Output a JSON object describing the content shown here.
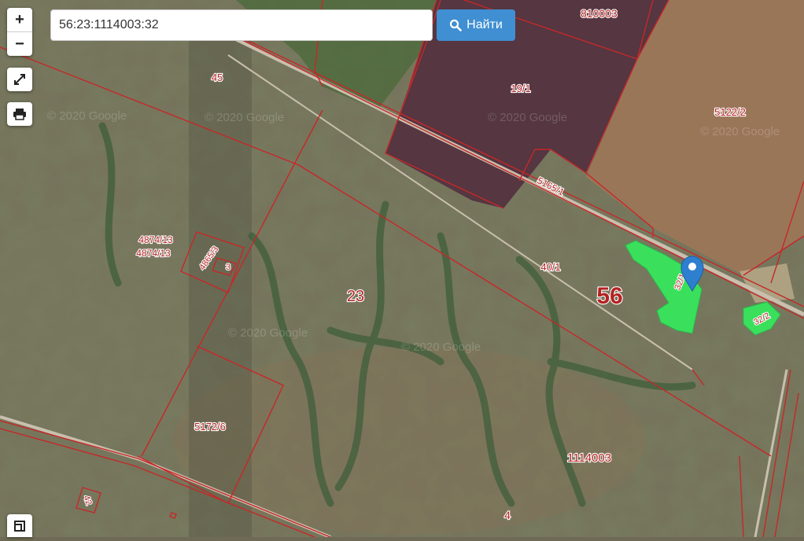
{
  "search": {
    "value": "56:23:1114003:32",
    "button_label": "Найти"
  },
  "controls": {
    "zoom_in": "+",
    "zoom_out": "−"
  },
  "labels": {
    "quarter_810003": "810003",
    "parcel_19_1": "19/1",
    "parcel_5122_2": "5122/2",
    "parcel_45": "45",
    "parcel_5165_1": "5165/1",
    "parcel_4874_13_a": "4874/13",
    "parcel_4874_13_b": "4874/13",
    "parcel_4865_3": "4865/3",
    "parcel_3": "3",
    "parcel_40_1": "40/1",
    "region_56": "56",
    "district_23": "23",
    "parcel_32_1": "32/1",
    "parcel_32_2": "32/2",
    "parcel_5172_6": "5172/6",
    "quarter_1114003": "1114003",
    "parcel_4": "4",
    "parcel_42": "42"
  },
  "watermarks": [
    "© 2020 Google",
    "© 2020 Google",
    "© 2020 Google",
    "© 2020 Google",
    "© 2020 Google",
    "© 2020 Google"
  ],
  "colors": {
    "boundary": "#c62828",
    "highlight": "#39e05a",
    "marker": "#2f7fd0",
    "button": "#3f8fd2"
  }
}
